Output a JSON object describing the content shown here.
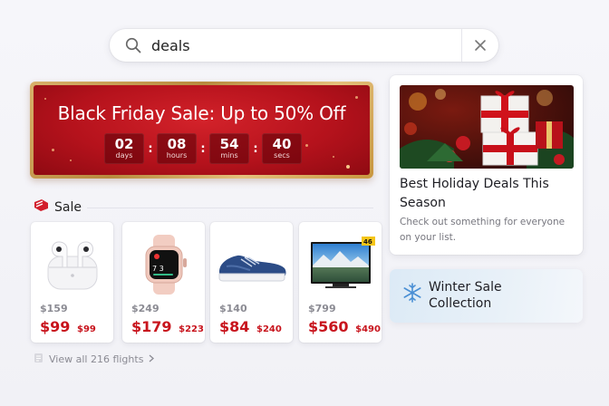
{
  "search": {
    "query": "deals"
  },
  "banner": {
    "title": "Black Friday Sale: Up to 50% Off",
    "countdown": [
      {
        "value": "02",
        "unit": "days"
      },
      {
        "value": "08",
        "unit": "hours"
      },
      {
        "value": "54",
        "unit": "mins"
      },
      {
        "value": "40",
        "unit": "secs"
      }
    ],
    "separator": ":"
  },
  "sale": {
    "label": "Sale",
    "products": [
      {
        "icon": "earbuds-icon",
        "original_price": "$159",
        "price": "$99",
        "was_price": "$99"
      },
      {
        "icon": "smartwatch-icon",
        "original_price": "$249",
        "price": "$179",
        "was_price": "$223"
      },
      {
        "icon": "sneaker-icon",
        "original_price": "$140",
        "price": "$84",
        "was_price": "$240"
      },
      {
        "icon": "television-icon",
        "original_price": "$799",
        "price": "$560",
        "was_price": "$490"
      }
    ],
    "view_all": "View all 216 flights"
  },
  "holiday": {
    "title": "Best Holiday Deals This Season",
    "description": "Check out something for everyone on your list."
  },
  "winter": {
    "title": "Winter Sale Collection"
  },
  "tv_badge": "46",
  "watch_screen": "7 3",
  "colors": {
    "accent_red": "#c8141d",
    "banner_red": "#b5121c",
    "gold": "#d8b06a"
  }
}
